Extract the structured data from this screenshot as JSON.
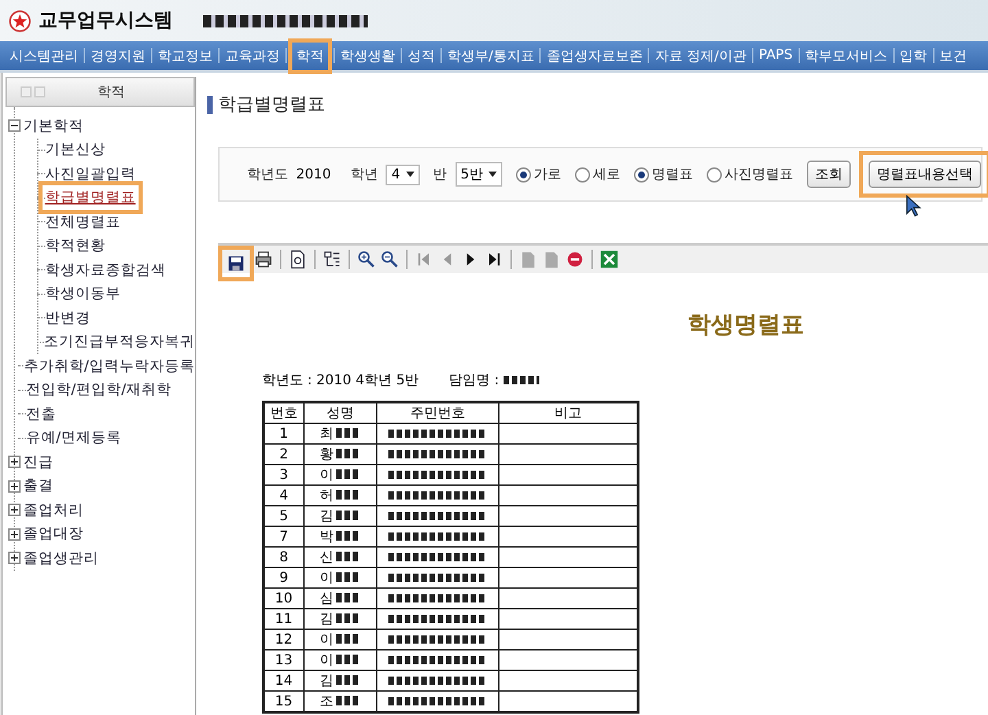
{
  "app": {
    "title": "교무업무시스템"
  },
  "nav": [
    {
      "label": "시스템관리",
      "highlighted": false
    },
    {
      "label": "경영지원",
      "highlighted": false
    },
    {
      "label": "학교정보",
      "highlighted": false
    },
    {
      "label": "교육과정",
      "highlighted": false
    },
    {
      "label": "학적",
      "highlighted": true
    },
    {
      "label": "학생생활",
      "highlighted": false
    },
    {
      "label": "성적",
      "highlighted": false
    },
    {
      "label": "학생부/통지표",
      "highlighted": false
    },
    {
      "label": "졸업생자료보존",
      "highlighted": false
    },
    {
      "label": "자료 정제/이관",
      "highlighted": false
    },
    {
      "label": "PAPS",
      "highlighted": false
    },
    {
      "label": "학부모서비스",
      "highlighted": false
    },
    {
      "label": "입학",
      "highlighted": false
    },
    {
      "label": "보건",
      "highlighted": false
    }
  ],
  "sidebar": {
    "title": "학적",
    "tree": [
      {
        "label": "기본학적",
        "expanded": true,
        "highlighted": false,
        "children": [
          {
            "label": "기본신상",
            "highlighted": false
          },
          {
            "label": "사진일괄입력",
            "highlighted": false
          },
          {
            "label": "학급별명렬표",
            "highlighted": true
          },
          {
            "label": "전체명렬표",
            "highlighted": false
          },
          {
            "label": "학적현황",
            "highlighted": false
          },
          {
            "label": "학생자료종합검색",
            "highlighted": false
          },
          {
            "label": "학생이동부",
            "highlighted": false
          },
          {
            "label": "반변경",
            "highlighted": false
          },
          {
            "label": "조기진급부적응자복귀",
            "highlighted": false
          }
        ]
      },
      {
        "label": "추가취학/입력누락자등록",
        "highlighted": false
      },
      {
        "label": "전입학/편입학/재취학",
        "highlighted": false
      },
      {
        "label": "전출",
        "highlighted": false
      },
      {
        "label": "유예/면제등록",
        "highlighted": false
      },
      {
        "label": "진급",
        "expanded": false,
        "highlighted": false
      },
      {
        "label": "출결",
        "expanded": false,
        "highlighted": false
      },
      {
        "label": "졸업처리",
        "expanded": false,
        "highlighted": false
      },
      {
        "label": "졸업대장",
        "expanded": false,
        "highlighted": false
      },
      {
        "label": "졸업생관리",
        "expanded": false,
        "highlighted": false
      }
    ]
  },
  "page": {
    "title": "학급별명렬표"
  },
  "filter": {
    "year_label": "학년도",
    "year": "2010",
    "grade_label": "학년",
    "grade": "4",
    "class_label": "반",
    "class": "5반",
    "radios": [
      {
        "label": "가로",
        "selected": true
      },
      {
        "label": "세로",
        "selected": false
      },
      {
        "label": "명렬표",
        "selected": true
      },
      {
        "label": "사진명렬표",
        "selected": false
      }
    ],
    "buttons": [
      {
        "label": "조회",
        "highlighted": false
      },
      {
        "label": "명렬표내용선택",
        "highlighted": true
      }
    ]
  },
  "toolbar": [
    {
      "kind": "save",
      "highlighted": true
    },
    {
      "kind": "print",
      "highlighted": false
    },
    {
      "kind": "sep"
    },
    {
      "kind": "page",
      "highlighted": false
    },
    {
      "kind": "sep"
    },
    {
      "kind": "tree",
      "highlighted": false
    },
    {
      "kind": "sep"
    },
    {
      "kind": "zoom-in",
      "highlighted": false
    },
    {
      "kind": "zoom-out",
      "highlighted": false
    },
    {
      "kind": "sep"
    },
    {
      "kind": "first",
      "highlighted": false
    },
    {
      "kind": "prev",
      "highlighted": false
    },
    {
      "kind": "next",
      "highlighted": false
    },
    {
      "kind": "last",
      "highlighted": false
    },
    {
      "kind": "sep"
    },
    {
      "kind": "doc",
      "highlighted": false
    },
    {
      "kind": "doc",
      "highlighted": false
    },
    {
      "kind": "stop",
      "highlighted": false
    },
    {
      "kind": "sep"
    },
    {
      "kind": "excel",
      "highlighted": false
    }
  ],
  "report": {
    "title": "학생명렬표",
    "info": "학년도 : 2010  4학년 5반",
    "teacher_label": "담임명 :",
    "columns": [
      "번호",
      "성명",
      "주민번호",
      "비고"
    ],
    "rows": [
      {
        "no": "1",
        "surname": "최"
      },
      {
        "no": "2",
        "surname": "황"
      },
      {
        "no": "3",
        "surname": "이"
      },
      {
        "no": "4",
        "surname": "허"
      },
      {
        "no": "5",
        "surname": "김"
      },
      {
        "no": "7",
        "surname": "박"
      },
      {
        "no": "8",
        "surname": "신"
      },
      {
        "no": "9",
        "surname": "이"
      },
      {
        "no": "10",
        "surname": "심"
      },
      {
        "no": "11",
        "surname": "김"
      },
      {
        "no": "12",
        "surname": "이"
      },
      {
        "no": "13",
        "surname": "이"
      },
      {
        "no": "14",
        "surname": "김"
      },
      {
        "no": "15",
        "surname": "조"
      }
    ]
  }
}
